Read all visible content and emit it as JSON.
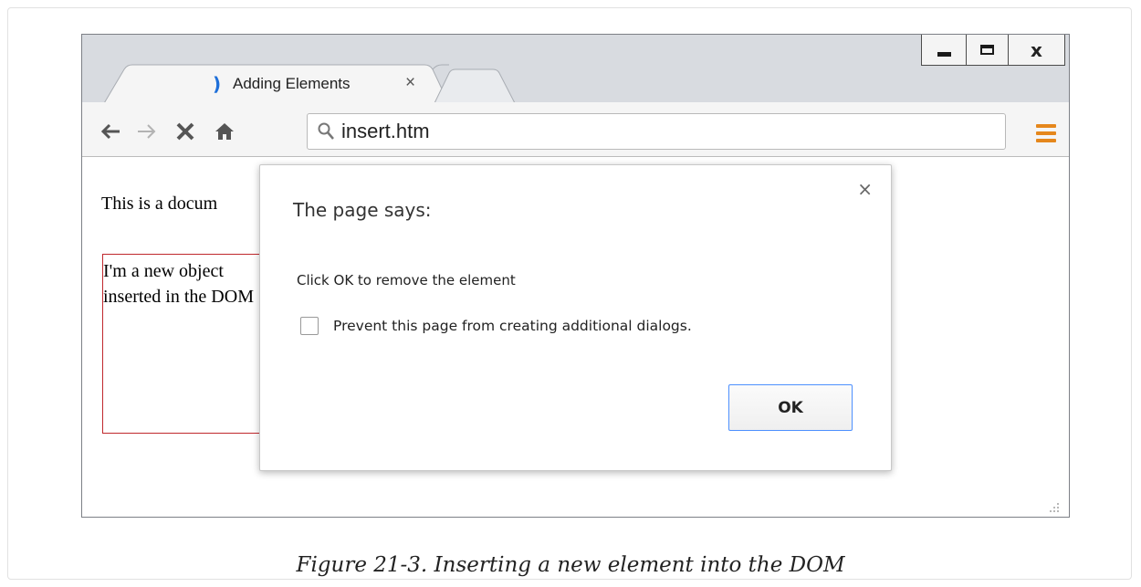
{
  "window": {
    "tab_title": "Adding Elements",
    "tab_close": "×",
    "controls": {
      "close": "x"
    }
  },
  "toolbar": {
    "address": "insert.htm",
    "icons": [
      "back-arrow-icon",
      "forward-arrow-icon",
      "stop-icon",
      "home-icon",
      "search-icon",
      "menu-icon"
    ]
  },
  "page": {
    "intro_text": "This is a docum",
    "box_text": "I'm a new object inserted in the DOM"
  },
  "dialog": {
    "title": "The page says:",
    "close": "×",
    "message": "Click OK to remove the element",
    "checkbox_label": "Prevent this page from creating additional dialogs.",
    "checkbox_checked": false,
    "ok_label": "OK"
  },
  "caption": "Figure 21-3. Inserting a new element into the DOM",
  "colors": {
    "accent_blue": "#4d90fe",
    "menu_orange": "#e5871c",
    "box_border_red": "#c0282d"
  }
}
